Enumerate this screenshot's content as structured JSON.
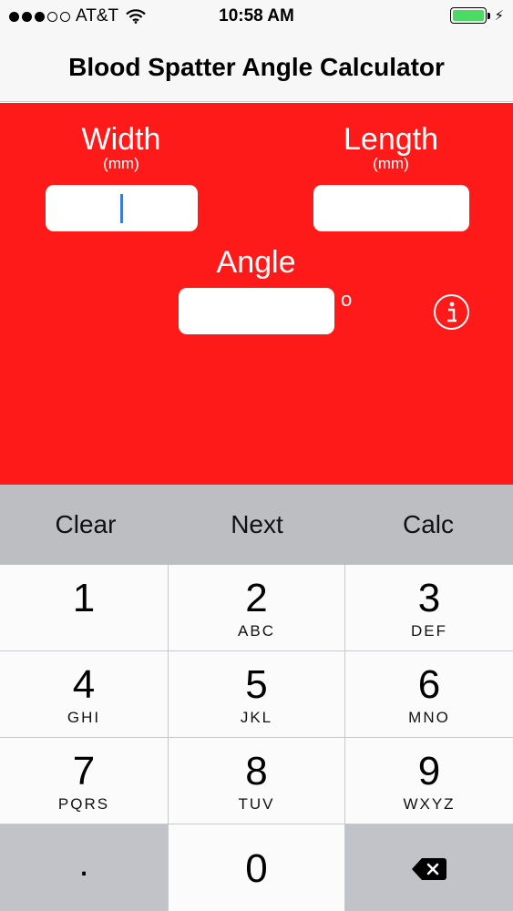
{
  "status_bar": {
    "signal_filled": 3,
    "signal_total": 5,
    "carrier": "AT&T",
    "wifi_icon": "wifi-icon",
    "time": "10:58 AM",
    "battery_level": 1.0,
    "battery_color": "#4cd964",
    "charging_icon": "bolt-icon"
  },
  "nav": {
    "title": "Blood Spatter Angle Calculator"
  },
  "panel": {
    "background": "#ff1a1a",
    "width_label": "Width",
    "width_unit": "(mm)",
    "width_value": "",
    "length_label": "Length",
    "length_unit": "(mm)",
    "length_value": "",
    "angle_label": "Angle",
    "angle_value": "",
    "degree_symbol": "o",
    "info_icon": "info-icon"
  },
  "toolbar": {
    "clear": "Clear",
    "next": "Next",
    "calc": "Calc"
  },
  "keypad": {
    "keys": [
      {
        "num": "1",
        "letters": ""
      },
      {
        "num": "2",
        "letters": "ABC"
      },
      {
        "num": "3",
        "letters": "DEF"
      },
      {
        "num": "4",
        "letters": "GHI"
      },
      {
        "num": "5",
        "letters": "JKL"
      },
      {
        "num": "6",
        "letters": "MNO"
      },
      {
        "num": "7",
        "letters": "PQRS"
      },
      {
        "num": "8",
        "letters": "TUV"
      },
      {
        "num": "9",
        "letters": "WXYZ"
      }
    ],
    "decimal": ".",
    "zero": "0",
    "backspace_icon": "backspace-icon"
  }
}
